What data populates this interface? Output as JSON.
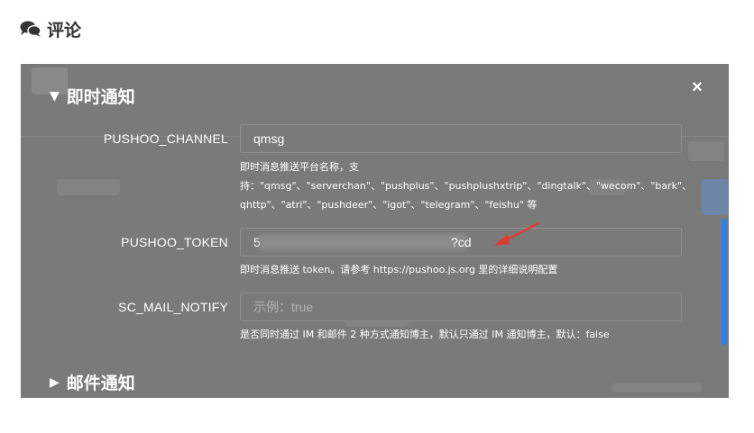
{
  "page": {
    "section_title": "评论",
    "section_icon": "comments-icon"
  },
  "modal": {
    "close_label": "×",
    "group_instant": {
      "label": "即时通知",
      "expanded": true,
      "toggle_icon": "▼"
    },
    "group_mail": {
      "label": "邮件通知",
      "expanded": false,
      "toggle_icon": "▶"
    },
    "fields": {
      "channel": {
        "label": "PUSHOO_CHANNEL",
        "value": "qmsg",
        "help_line1": "即时消息推送平台名称，支",
        "help_line2": "持：\"qmsg\"、\"serverchan\"、\"pushplus\"、\"pushplushxtrip\"、\"dingtalk\"、\"wecom\"、\"bark\"、\"goc",
        "help_line3": "qhttp\"、\"atri\"、\"pushdeer\"、\"igot\"、\"telegram\"、\"feishu\" 等"
      },
      "token": {
        "label": "PUSHOO_TOKEN",
        "value_start": "5",
        "value_end": "?cd",
        "help": "即时消息推送 token。请参考 https://pushoo.js.org 里的详细说明配置"
      },
      "mail_notify": {
        "label": "SC_MAIL_NOTIFY",
        "placeholder": "示例：true",
        "help": "是否同时通过 IM 和邮件 2 种方式通知博主，默认只通过 IM 通知博主，默认：false"
      }
    },
    "annotation_color": "#e03a2e",
    "scrollbar_color": "#2e7ff0"
  }
}
